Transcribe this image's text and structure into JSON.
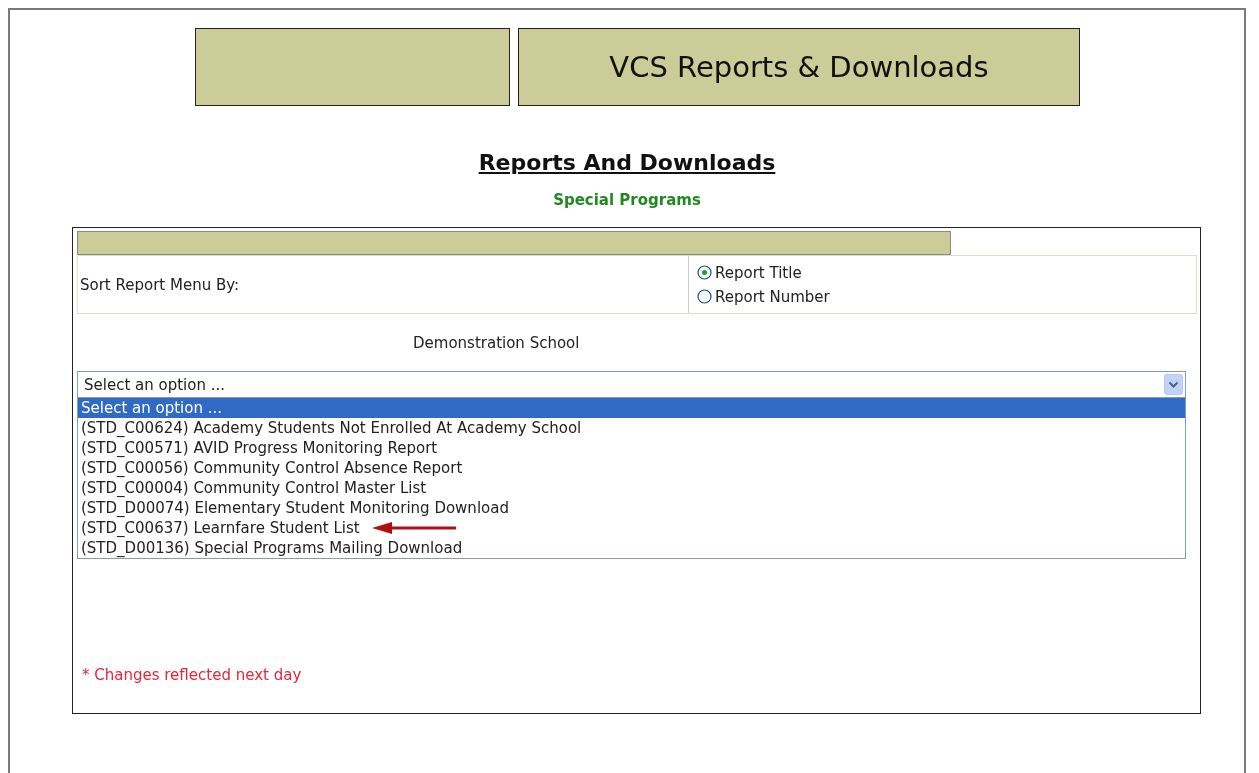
{
  "banner": {
    "title": "VCS Reports & Downloads"
  },
  "heading": "Reports And Downloads",
  "subheading": "Special Programs",
  "sort": {
    "label": "Sort Report Menu By:",
    "options": [
      {
        "label": "Report Title",
        "selected": true
      },
      {
        "label": "Report Number",
        "selected": false
      }
    ]
  },
  "school": "Demonstration School",
  "report_select": {
    "value": "Select an option ...",
    "options": [
      {
        "label": "Select an option ...",
        "selected": true,
        "pointed": false
      },
      {
        "label": "(STD_C00624) Academy Students Not Enrolled At Academy School",
        "selected": false,
        "pointed": false
      },
      {
        "label": "(STD_C00571) AVID Progress Monitoring Report",
        "selected": false,
        "pointed": false
      },
      {
        "label": "(STD_C00056) Community Control Absence Report",
        "selected": false,
        "pointed": false
      },
      {
        "label": "(STD_C00004) Community Control Master List",
        "selected": false,
        "pointed": false
      },
      {
        "label": "(STD_D00074) Elementary Student Monitoring Download",
        "selected": false,
        "pointed": false
      },
      {
        "label": "(STD_C00637) Learnfare Student List",
        "selected": false,
        "pointed": true
      },
      {
        "label": "(STD_D00136) Special Programs Mailing Download",
        "selected": false,
        "pointed": false
      }
    ]
  },
  "note": "* Changes reflected next day"
}
